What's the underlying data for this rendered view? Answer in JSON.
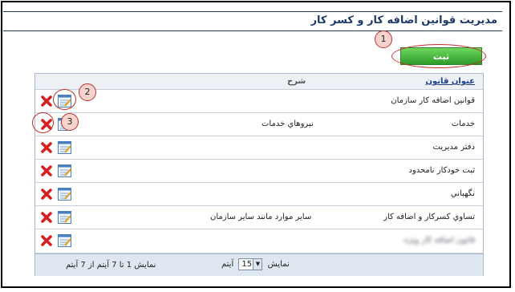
{
  "page": {
    "title": "مديريت قوانين اضافه كار و كسر كار"
  },
  "toolbar": {
    "submit_label": "ثبت"
  },
  "callouts": [
    "1",
    "2",
    "3"
  ],
  "table": {
    "headers": {
      "name": "عنوان قانون",
      "description": "شرح"
    },
    "rows": [
      {
        "name": "قوانين اضافه كار سازمان",
        "description": ""
      },
      {
        "name": "خدمات",
        "description": "نيروهاي خدمات"
      },
      {
        "name": "دفتر مديريت",
        "description": ""
      },
      {
        "name": "ثبت خودكار نامحدود",
        "description": ""
      },
      {
        "name": "نگهباني",
        "description": ""
      },
      {
        "name": "تساوي كسركار و اضافه كار",
        "description": "ساير موارد مانند ساير سازمان"
      },
      {
        "name": "قانون اضافه كار ويژه",
        "description": ""
      }
    ]
  },
  "pager": {
    "show_label": "نمايش",
    "page_size": "15",
    "items_label": "آيتم",
    "summary": "نمايش 1 تا 7 آيتم از 7 آيتم"
  },
  "icons": {
    "delete": "delete-x-icon",
    "edit": "edit-form-icon"
  },
  "colors": {
    "accent": "#1e3a6a",
    "submit_button": "#3cb043",
    "callout": "#c0302a",
    "delete": "#d61f1f",
    "header_bg": "#edf1f6",
    "footer_bg": "#dfe7f1"
  }
}
